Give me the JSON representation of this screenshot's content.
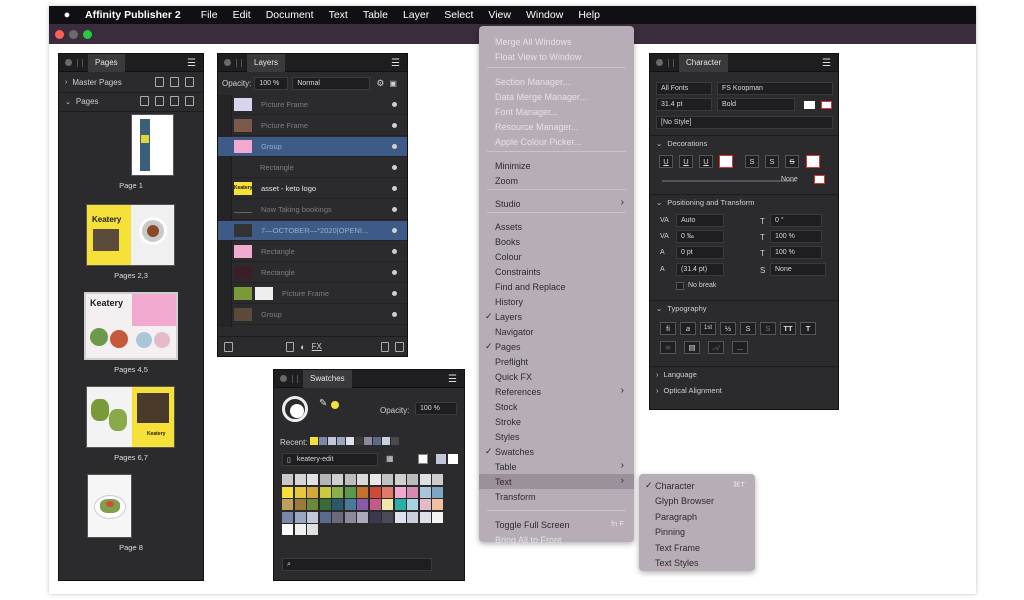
{
  "menubar": {
    "app_name": "Affinity Publisher 2",
    "items": [
      "File",
      "Edit",
      "Document",
      "Text",
      "Table",
      "Layer",
      "Select",
      "View",
      "Window",
      "Help"
    ]
  },
  "pages_panel": {
    "tab": "Pages",
    "master_pages": "Master Pages",
    "pages_label": "Pages",
    "page_labels": [
      "Page 1",
      "Pages 2,3",
      "Pages 4,5",
      "Pages 6,7",
      "Page 8"
    ],
    "thumb_text": [
      "Keatery",
      "Keatery",
      "Keatery"
    ]
  },
  "layers_panel": {
    "tab": "Layers",
    "opacity_label": "Opacity:",
    "opacity_value": "100 %",
    "blend_mode": "Normal",
    "rows": [
      {
        "name": "Picture Frame"
      },
      {
        "name": "Picture Frame"
      },
      {
        "name": "Group"
      },
      {
        "name": "Rectangle"
      },
      {
        "name": "asset - keto logo"
      },
      {
        "name": "Now Taking bookings"
      },
      {
        "name": "7—OCTOBER—*2020|OPENI..."
      },
      {
        "name": "Rectangle"
      },
      {
        "name": "Rectangle"
      },
      {
        "name": "Picture Frame"
      },
      {
        "name": "Group"
      }
    ],
    "thumb_logo_text": "Keatery",
    "fx_label": "FX"
  },
  "swatches_panel": {
    "tab": "Swatches",
    "opacity_label": "Opacity:",
    "opacity_value": "100 %",
    "recent_label": "Recent:",
    "palette_name": "keatery-edit"
  },
  "view_menu": {
    "items": [
      {
        "label": "Merge All Windows",
        "disabled": true
      },
      {
        "label": "Float View to Window",
        "disabled": true
      },
      {
        "label": "Section Manager...",
        "disabled": true
      },
      {
        "label": "Data Merge Manager...",
        "disabled": true
      },
      {
        "label": "Font Manager...",
        "disabled": true
      },
      {
        "label": "Resource Manager...",
        "disabled": true
      },
      {
        "label": "Apple Colour Picker...",
        "disabled": true
      },
      {
        "label": "Minimize"
      },
      {
        "label": "Zoom"
      },
      {
        "label": "Studio"
      },
      {
        "label": "Assets"
      },
      {
        "label": "Books"
      },
      {
        "label": "Colour"
      },
      {
        "label": "Constraints"
      },
      {
        "label": "Find and Replace"
      },
      {
        "label": "History"
      },
      {
        "label": "Layers"
      },
      {
        "label": "Navigator"
      },
      {
        "label": "Pages"
      },
      {
        "label": "Preflight"
      },
      {
        "label": "Quick FX"
      },
      {
        "label": "References"
      },
      {
        "label": "Stock"
      },
      {
        "label": "Stroke"
      },
      {
        "label": "Styles"
      },
      {
        "label": "Swatches"
      },
      {
        "label": "Table"
      },
      {
        "label": "Text"
      },
      {
        "label": "Transform"
      },
      {
        "label": "Toggle Full Screen",
        "shortcut": "fn F"
      },
      {
        "label": "Bring All to Front",
        "disabled": true
      }
    ],
    "check_mark": "✓",
    "submenu_arrow": "›"
  },
  "text_submenu": {
    "items": [
      {
        "label": "Character",
        "shortcut": "⌘T"
      },
      {
        "label": "Glyph Browser"
      },
      {
        "label": "Paragraph"
      },
      {
        "label": "Pinning"
      },
      {
        "label": "Text Frame"
      },
      {
        "label": "Text Styles"
      }
    ]
  },
  "character_panel": {
    "tab": "Character",
    "font_collection": "All Fonts",
    "font_family": "FS Koopman",
    "font_size": "31.4 pt",
    "font_weight": "Bold",
    "style": "[No Style]",
    "decorations_label": "Decorations",
    "decoration_glyphs": [
      "U",
      "U",
      "U",
      "",
      "S",
      "S",
      "S",
      ""
    ],
    "none_label": "None",
    "positioning_label": "Positioning and Transform",
    "pos_fields": {
      "kerning": "Auto",
      "tracking": "0 ‰",
      "baseline": "0 pt",
      "leading": "(31.4 pt)",
      "rotation": "0 °",
      "vscale": "100 %",
      "hscale": "100 %",
      "shear": "None"
    },
    "no_break": "No break",
    "typography_label": "Typography",
    "typo_glyphs": [
      "fi",
      "a",
      "1st",
      "½",
      "S",
      "S",
      "TT",
      "T"
    ],
    "typo_more": "...",
    "language_label": "Language",
    "optical_label": "Optical Alignment"
  }
}
